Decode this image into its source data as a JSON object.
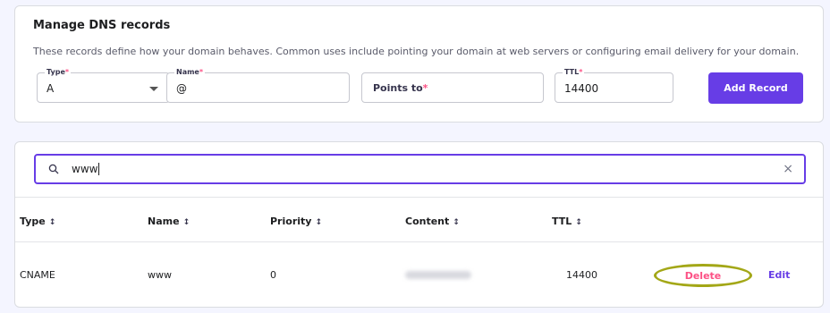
{
  "manage": {
    "title": "Manage DNS records",
    "description": "These records define how your domain behaves. Common uses include pointing your domain at web servers or configuring email delivery for your domain.",
    "type_field": {
      "label": "Type",
      "value": "A"
    },
    "name_field": {
      "label": "Name",
      "value": "@"
    },
    "points_field": {
      "placeholder": "Points to"
    },
    "ttl_field": {
      "label": "TTL",
      "value": "14400"
    },
    "required_mark": "*",
    "add_button": "Add Record"
  },
  "search": {
    "value": "www",
    "clear_symbol": "×"
  },
  "table": {
    "headers": [
      {
        "label": "Type",
        "sort": "↕"
      },
      {
        "label": "Name",
        "sort": "↕"
      },
      {
        "label": "Priority",
        "sort": "↕"
      },
      {
        "label": "Content",
        "sort": "↕"
      },
      {
        "label": "TTL",
        "sort": "↕"
      }
    ],
    "rows": [
      {
        "type": "CNAME",
        "name": "www",
        "priority": "0",
        "content": "",
        "ttl": "14400",
        "delete_label": "Delete",
        "edit_label": "Edit"
      }
    ]
  },
  "colors": {
    "accent": "#673de6",
    "danger": "#fc5185",
    "highlight_ring": "#a3a717",
    "background": "#f4f5ff"
  },
  "icons": {
    "search": "search-icon",
    "clear": "close-icon",
    "select": "chevron-down-icon",
    "sort": "sort-icon"
  }
}
